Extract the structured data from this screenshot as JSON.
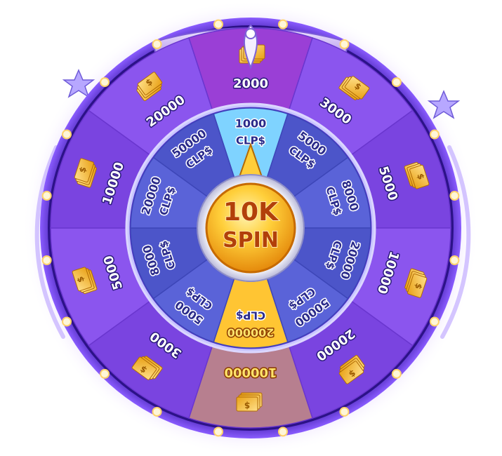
{
  "outer_ring": {
    "segments": [
      {
        "label": "2000",
        "highlight": true
      },
      {
        "label": "3000"
      },
      {
        "label": "5000"
      },
      {
        "label": "10000"
      },
      {
        "label": "20000"
      },
      {
        "label": "100000",
        "gold": true,
        "highlight": true
      },
      {
        "label": "3000"
      },
      {
        "label": "5000"
      },
      {
        "label": "10000"
      },
      {
        "label": "20000"
      }
    ],
    "ticket_icon": "cash-ticket-icon"
  },
  "inner_ring": {
    "currency": "CLP$",
    "segments": [
      {
        "label": "1000",
        "highlight": true
      },
      {
        "label": "5000"
      },
      {
        "label": "8000"
      },
      {
        "label": "20000"
      },
      {
        "label": "50000"
      },
      {
        "label": "200000",
        "gold": true
      },
      {
        "label": "5000"
      },
      {
        "label": "8000"
      },
      {
        "label": "20000"
      },
      {
        "label": "50000"
      }
    ]
  },
  "center_button": {
    "line1": "10K",
    "line2": "SPIN"
  },
  "colors": {
    "outer_a": "#7a44e0",
    "outer_b": "#8b55ee",
    "inner_a": "#5a63d8",
    "inner_b": "#4c55c9",
    "gold": "#ffc533",
    "rim": "#3a1a9a"
  }
}
